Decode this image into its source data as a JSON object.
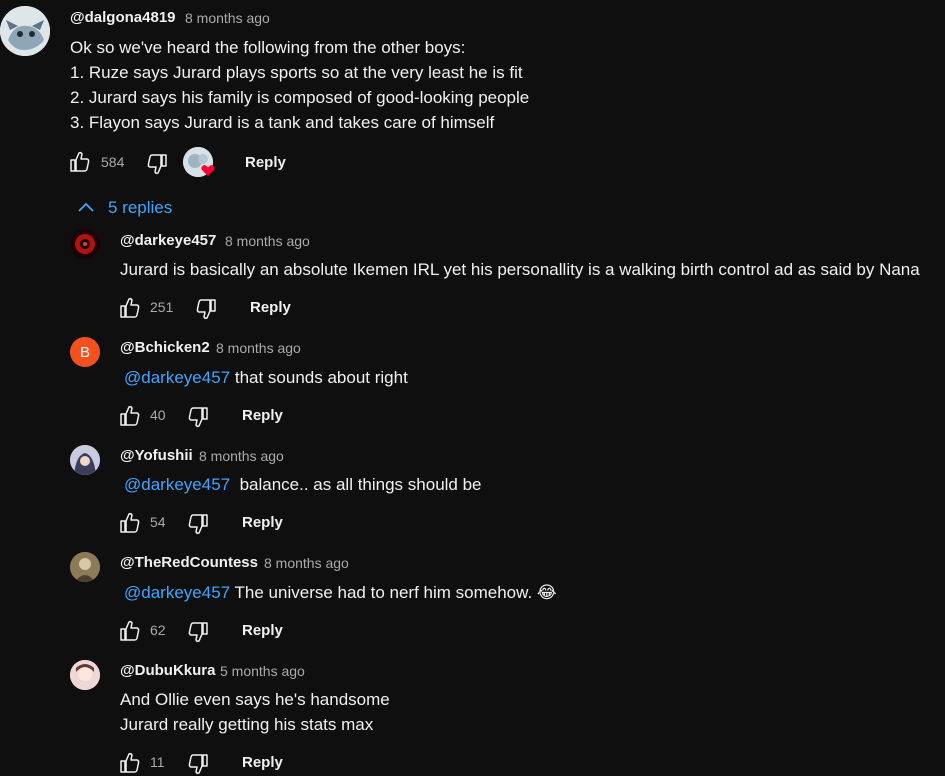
{
  "top_comment": {
    "author": "@dalgona4819",
    "time": "8 months ago",
    "lines": [
      "Ok so we've heard the following from the other boys:",
      "1. Ruze says Jurard plays sports so at the very least he is fit",
      "2. Jurard says his family is composed of good-looking people",
      "3. Flayon says Jurard is a tank and takes care of himself"
    ],
    "likes": "584",
    "reply_label": "Reply"
  },
  "replies_toggle": {
    "label": "5 replies",
    "icon": "chevron-up-icon"
  },
  "replies": [
    {
      "author": "@darkeye457",
      "time": "8 months ago",
      "mention": "",
      "text": "Jurard is basically an absolute Ikemen IRL yet his personallity is a walking birth control ad as said by Nana",
      "line2": "",
      "likes": "251",
      "reply_label": "Reply"
    },
    {
      "author": "@Bchicken2",
      "time": "8 months ago",
      "avatar_letter": "B",
      "mention": "@darkeye457",
      "text": "that sounds about right",
      "line2": "",
      "likes": "40",
      "reply_label": "Reply"
    },
    {
      "author": "@Yofushii",
      "time": "8 months ago",
      "mention": "@darkeye457",
      "text": " balance.. as all things should be",
      "line2": "",
      "likes": "54",
      "reply_label": "Reply"
    },
    {
      "author": "@TheRedCountess",
      "time": "8 months ago",
      "mention": "@darkeye457",
      "text": "The universe had to nerf him somehow. 😂",
      "line2": "",
      "likes": "62",
      "reply_label": "Reply"
    },
    {
      "author": "@DubuKkura",
      "time": "5 months ago",
      "mention": "",
      "text": "And Ollie even says he's handsome",
      "line2": "Jurard really getting his stats max",
      "likes": "11",
      "reply_label": "Reply"
    }
  ],
  "colors": {
    "background": "#0f0f0f",
    "text": "#f1f1f1",
    "secondary": "#aaaaaa",
    "link": "#3ea6ff",
    "bchicken_avatar": "#f4511e"
  }
}
